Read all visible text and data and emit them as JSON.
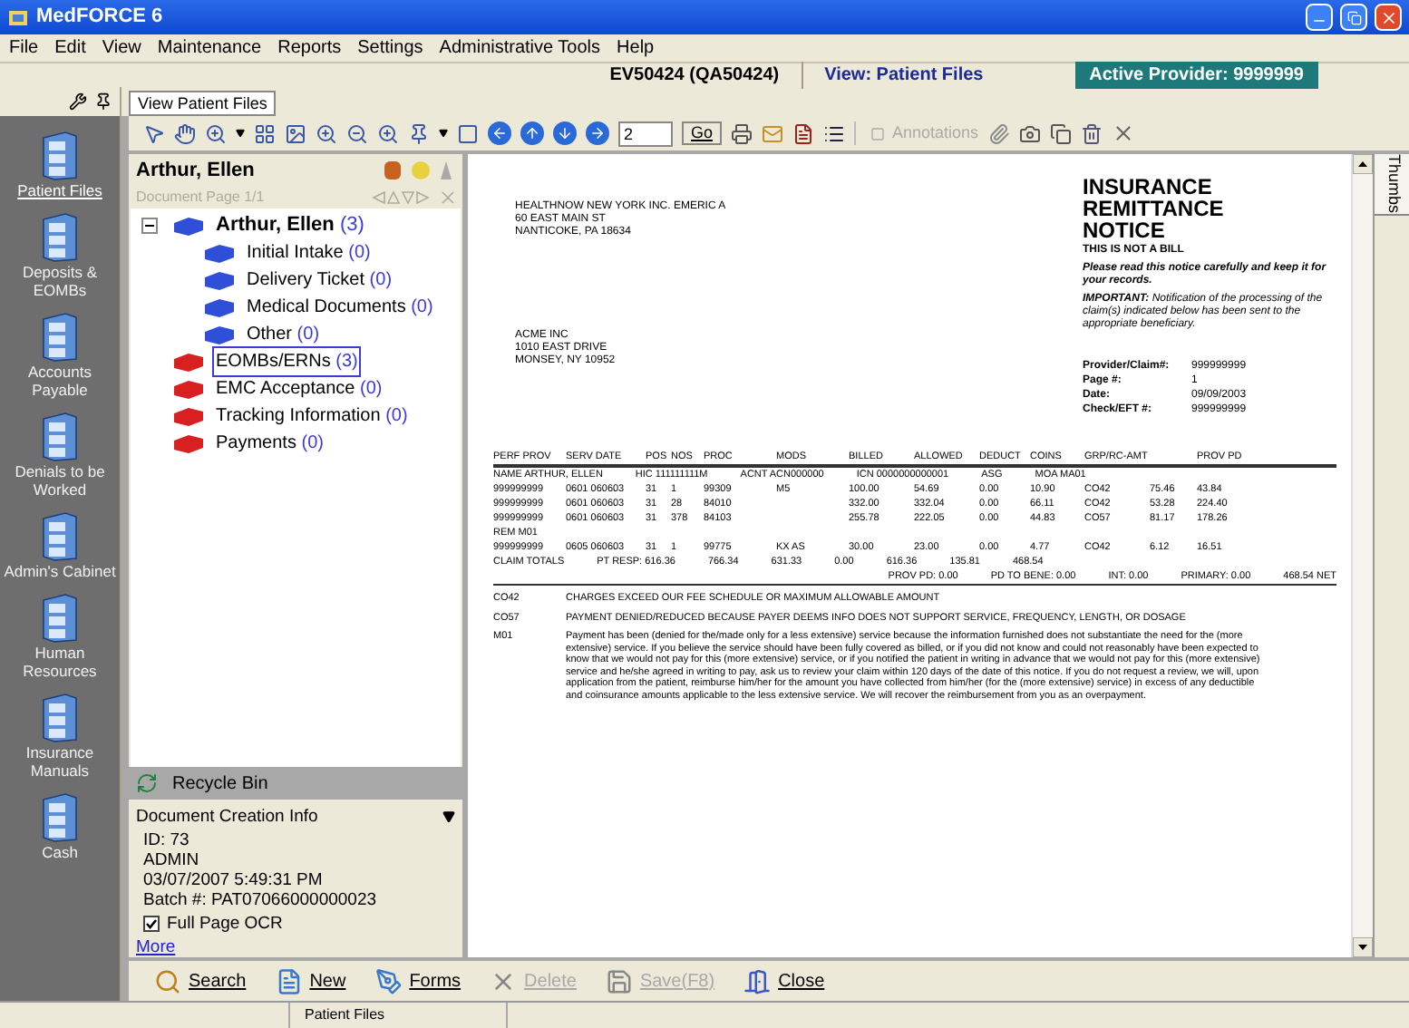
{
  "window": {
    "title": "MedFORCE 6"
  },
  "menu": [
    "File",
    "Edit",
    "View",
    "Maintenance",
    "Reports",
    "Settings",
    "Administrative Tools",
    "Help"
  ],
  "info_bar": {
    "document": "EV50424 (QA50424)",
    "view": "View: Patient Files",
    "provider": "Active Provider: 9999999"
  },
  "view_tab": "View Patient Files",
  "sidebar": {
    "items": [
      {
        "label": "Patient Files",
        "selected": true
      },
      {
        "label": "Deposits & EOMBs",
        "selected": false
      },
      {
        "label": "Accounts Payable",
        "selected": false
      },
      {
        "label": "Denials to be Worked",
        "selected": false
      },
      {
        "label": "Admin's Cabinet",
        "selected": false
      },
      {
        "label": "Human Resources",
        "selected": false
      },
      {
        "label": "Insurance Manuals",
        "selected": false
      },
      {
        "label": "Cash",
        "selected": false
      }
    ]
  },
  "toolbar": {
    "page": "2",
    "go": "Go",
    "annotations": "Annotations"
  },
  "file_panel": {
    "patient": "Arthur, Ellen",
    "page": "Document Page 1/1",
    "tree": [
      {
        "label": "Arthur, Ellen",
        "count": "(3)",
        "color": "#2f4fd8",
        "selected": false,
        "expanded": true,
        "children": [
          {
            "label": "Initial Intake",
            "count": "(0)",
            "color": "#2f4fd8",
            "selected": false
          },
          {
            "label": "Delivery Ticket",
            "count": "(0)",
            "color": "#2f4fd8",
            "selected": false
          },
          {
            "label": "Medical Documents",
            "count": "(0)",
            "color": "#2f4fd8",
            "selected": false
          },
          {
            "label": "Other",
            "count": "(0)",
            "color": "#2f4fd8",
            "selected": false
          }
        ]
      },
      {
        "label": "EOMBs/ERNs",
        "count": "(3)",
        "color": "#d82020",
        "selected": true
      },
      {
        "label": "EMC Acceptance",
        "count": "(0)",
        "color": "#d82020",
        "selected": false
      },
      {
        "label": "Tracking Information",
        "count": "(0)",
        "color": "#d82020",
        "selected": false
      },
      {
        "label": "Payments",
        "count": "(0)",
        "color": "#d82020",
        "selected": false
      }
    ],
    "recycle_bin": "Recycle Bin",
    "creation_info": {
      "title": "Document Creation Info",
      "lines": [
        "ID: 73",
        "ADMIN",
        "03/07/2007 5:49:31 PM",
        "Batch #: PAT07066000000023"
      ],
      "ocr": {
        "label": "Full Page OCR",
        "checked": true
      },
      "more": "More"
    }
  },
  "document": {
    "sender": [
      "HEALTHNOW NEW YORK INC. EMERIC A",
      "60 EAST MAIN ST",
      "NANTICOKE, PA 18634"
    ],
    "recipient": [
      "ACME INC",
      "1010 EAST DRIVE",
      "MONSEY, NY 10952"
    ],
    "title": [
      "INSURANCE",
      "REMITTANCE",
      "NOTICE"
    ],
    "not_bill": "THIS IS NOT A BILL",
    "notice": "Please read this notice carefully and keep it for your records.",
    "important": "**IMPORTANT:** Notification of the processing of the claim(s) indicated below has been sent to the appropriate beneficiary.",
    "fields": [
      {
        "label": "Provider/Claim#:",
        "value": "999999999"
      },
      {
        "label": "Page #:",
        "value": "1"
      },
      {
        "label": "Date:",
        "value": "09/09/2003"
      },
      {
        "label": "Check/EFT #:",
        "value": "999999999"
      }
    ],
    "table": {
      "columns": [
        "PERF PROV",
        "SERV DATE",
        "POS",
        "NOS",
        "PROC",
        "MODS",
        "BILLED",
        "ALLOWED",
        "DEDUCT",
        "COINS",
        "GRP/RC-AMT",
        "",
        "PROV PD"
      ],
      "rows": [
        {
          "kind": "summary",
          "items": [
            "NAME  ARTHUR, ELLEN",
            "HIC  111111111M",
            "ACNT  ACN000000",
            "ICN  0000000000001",
            "ASG",
            "MOA  MA01"
          ]
        },
        {
          "kind": "line",
          "cells": [
            "999999999",
            "0601  060603",
            "31",
            "1",
            "99309",
            "M5",
            "100.00",
            "54.69",
            "0.00",
            "10.90",
            "CO42",
            "75.46",
            "43.84"
          ]
        },
        {
          "kind": "line",
          "cells": [
            "999999999",
            "0601  060603",
            "31",
            "28",
            "84010",
            "",
            "332.00",
            "332.04",
            "0.00",
            "66.11",
            "CO42",
            "53.28",
            "224.40"
          ]
        },
        {
          "kind": "line",
          "cells": [
            "999999999",
            "0601  060603",
            "31",
            "378",
            "84103",
            "",
            "255.78",
            "222.05",
            "0.00",
            "44.83",
            "CO57",
            "81.17",
            "178.26"
          ]
        },
        {
          "kind": "summary",
          "items": [
            "REM  M01"
          ]
        },
        {
          "kind": "line",
          "cells": [
            "999999999",
            "0605  060603",
            "31",
            "1",
            "99775",
            "KX  AS",
            "30.00",
            "23.00",
            "0.00",
            "4.77",
            "CO42",
            "6.12",
            "16.51"
          ]
        },
        {
          "kind": "summary",
          "items": [
            "CLAIM TOTALS",
            "PT RESP: 616.36",
            "766.34",
            "631.33",
            "0.00",
            "616.36",
            "135.81",
            "468.54"
          ]
        },
        {
          "kind": "summary",
          "items": [
            "PROV PD: 0.00",
            "PD TO BENE: 0.00",
            "INT: 0.00",
            "PRIMARY: 0.00",
            "468.54 NET"
          ]
        }
      ]
    },
    "remarks": [
      {
        "code": "CO42",
        "text": "CHARGES EXCEED OUR FEE SCHEDULE OR MAXIMUM ALLOWABLE AMOUNT"
      },
      {
        "code": "CO57",
        "text": "PAYMENT DENIED/REDUCED BECAUSE PAYER DEEMS INFO DOES NOT SUPPORT SERVICE, FREQUENCY, LENGTH, OR DOSAGE"
      },
      {
        "code": "M01",
        "text": "Payment has been (denied for the/made only for a less extensive) service because the information furnished does not substantiate the need for the (more extensive) service. If you believe the service should have been fully covered as billed, or if you did not know and could not reasonably have been expected to know that we would not pay for this (more extensive) service, or if you notified the patient in writing in advance that we would not pay for this (more extensive) service and he/she agreed in writing to pay, ask us to review your claim within 120 days of the date of this notice. If you do not request a review, we will, upon application from the patient, reimburse him/her for the amount you have collected from him/her (for the (more extensive) service) in excess of any deductible and coinsurance amounts applicable to the less extensive service. We will recover the reimbursement from you as an overpayment."
      }
    ]
  },
  "thumbs_tab": "Thumbs",
  "actions": [
    {
      "label": "Search",
      "kind": "search",
      "disabled": false
    },
    {
      "label": "New",
      "kind": "new",
      "disabled": false
    },
    {
      "label": "Forms",
      "kind": "forms",
      "disabled": false
    },
    {
      "label": "Delete",
      "kind": "delete",
      "disabled": true
    },
    {
      "label": "Save(F8)",
      "kind": "save",
      "disabled": true
    },
    {
      "label": "Close",
      "kind": "close",
      "disabled": false
    }
  ],
  "status_bar": [
    "Patient Files"
  ]
}
